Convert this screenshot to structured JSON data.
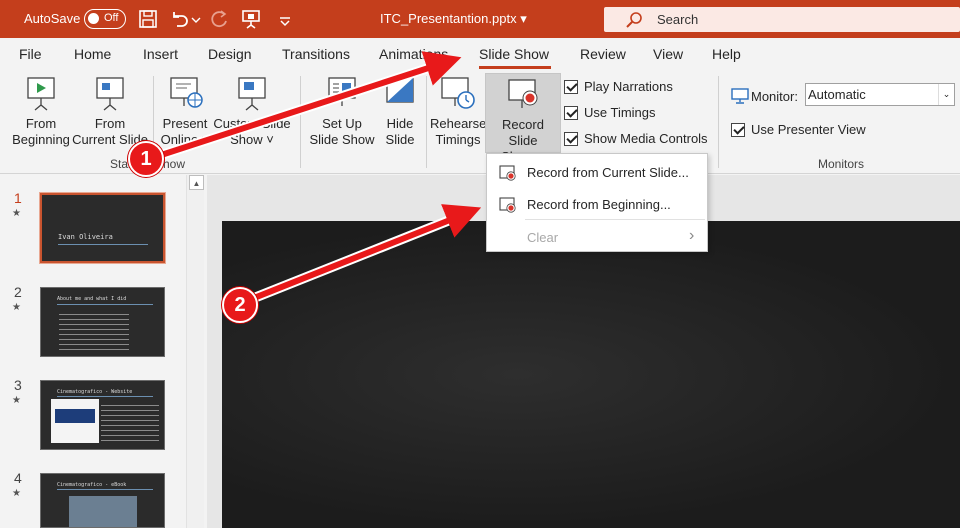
{
  "titlebar": {
    "autosave_label": "AutoSave",
    "autosave_state": "Off",
    "document_title": "ITC_Presentantion.pptx",
    "title_dropdown_glyph": "▾",
    "search_label": "Search"
  },
  "menu": {
    "tabs": [
      "File",
      "Home",
      "Insert",
      "Design",
      "Transitions",
      "Animations",
      "Slide Show",
      "Review",
      "View",
      "Help"
    ],
    "active_tab": "Slide Show"
  },
  "ribbon": {
    "start_group": {
      "from_beginning": [
        "From",
        "Beginning"
      ],
      "from_current": [
        "From",
        "Current Slide"
      ],
      "present_online": [
        "Present",
        "Online"
      ],
      "present_online_arrow": "˅",
      "custom_slide_show": [
        "Custom Slide",
        "Show"
      ],
      "custom_slide_show_arrow": "˅",
      "label_start": "Star",
      "label_end": "how"
    },
    "setup_group": {
      "set_up": [
        "Set Up",
        "Slide Show"
      ],
      "hide_slide": [
        "Hide",
        "Slide"
      ],
      "rehearse": [
        "Rehearse",
        "Timings"
      ],
      "record": [
        "Record Slide",
        "Show"
      ],
      "record_arrow": "˅",
      "play_narrations": "Play Narrations",
      "use_timings": "Use Timings",
      "show_media_controls": "Show Media Controls"
    },
    "monitors_group": {
      "monitor_label": "Monitor:",
      "monitor_value": "Automatic",
      "monitor_arrow": "⌄",
      "presenter_view": "Use Presenter View",
      "group_label": "Monitors"
    }
  },
  "dropdown": {
    "items": [
      {
        "label": "Record from Current Slide...",
        "enabled": true
      },
      {
        "label": "Record from Beginning...",
        "enabled": true
      },
      {
        "label": "Clear",
        "enabled": false
      }
    ],
    "submenu_glyph": "›"
  },
  "slides_pane": {
    "scroll_up_glyph": "▲",
    "star_glyph": "★",
    "numbers": [
      "1",
      "2",
      "3",
      "4"
    ],
    "slide1_title": "Ivan Oliveira",
    "slide2_title": "About me and what I did",
    "slide3_title": "Cinematografico - Website",
    "slide4_title": "Cinematografico - eBook"
  },
  "annotations": {
    "badges": [
      "1",
      "2"
    ],
    "color": "#e8191a"
  },
  "colors": {
    "brand": "#c43e1c",
    "ribbon_bg": "#f3f3f3",
    "record_dot": "#d9342b"
  }
}
